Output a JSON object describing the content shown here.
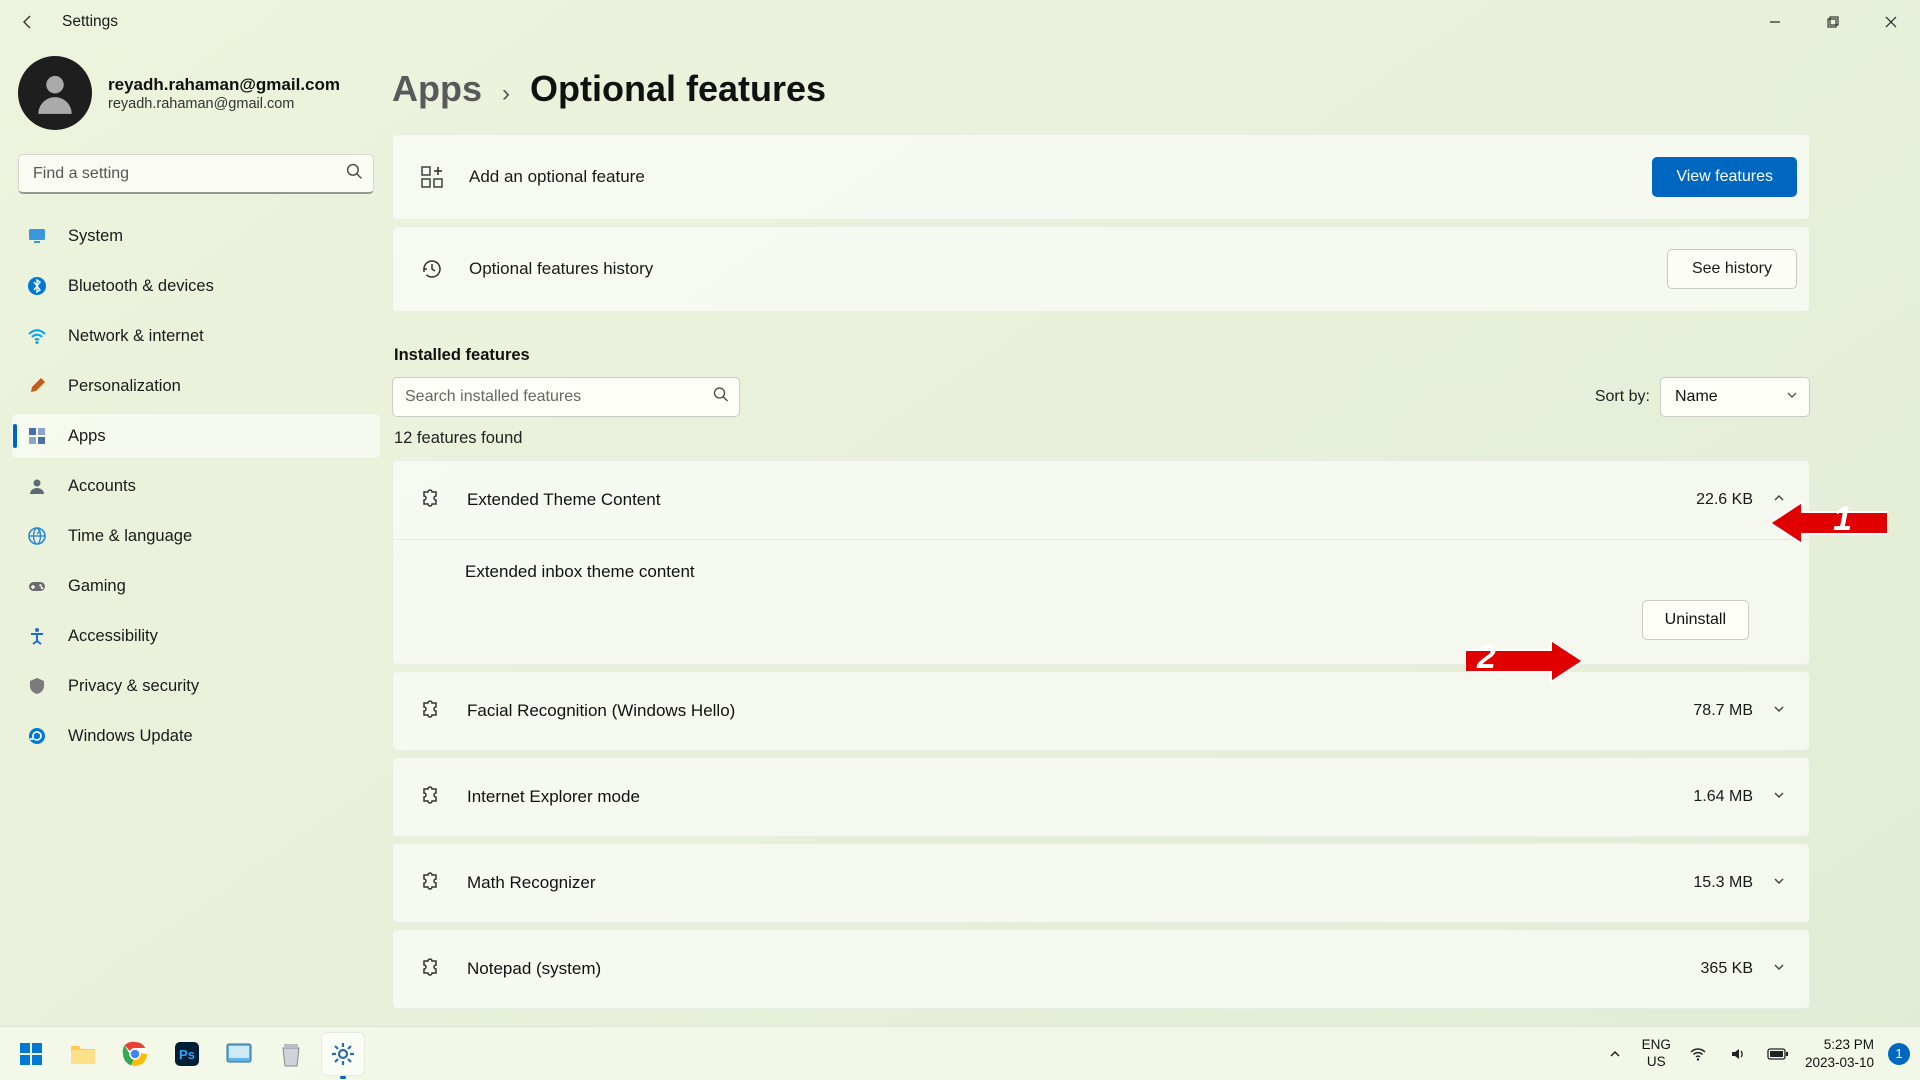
{
  "window": {
    "title": "Settings"
  },
  "profile": {
    "name": "reyadh.rahaman@gmail.com",
    "email": "reyadh.rahaman@gmail.com"
  },
  "search": {
    "placeholder": "Find a setting"
  },
  "nav": [
    {
      "label": "System",
      "icon": "monitor",
      "color": "#3a96dd"
    },
    {
      "label": "Bluetooth & devices",
      "icon": "bluetooth",
      "color": "#0078d4"
    },
    {
      "label": "Network & internet",
      "icon": "wifi",
      "color": "#00a4ef"
    },
    {
      "label": "Personalization",
      "icon": "brush",
      "color": "#c35b1a"
    },
    {
      "label": "Apps",
      "icon": "apps",
      "color": "#4a6fa5",
      "active": true
    },
    {
      "label": "Accounts",
      "icon": "user",
      "color": "#5b6b73"
    },
    {
      "label": "Time & language",
      "icon": "globe",
      "color": "#2b88d8"
    },
    {
      "label": "Gaming",
      "icon": "game",
      "color": "#6b6b6b"
    },
    {
      "label": "Accessibility",
      "icon": "access",
      "color": "#1c6dd0"
    },
    {
      "label": "Privacy & security",
      "icon": "shield",
      "color": "#7a7a7a"
    },
    {
      "label": "Windows Update",
      "icon": "update",
      "color": "#0078d4"
    }
  ],
  "breadcrumb": {
    "parent": "Apps",
    "current": "Optional features"
  },
  "cards": {
    "add": {
      "label": "Add an optional feature",
      "button": "View features"
    },
    "history": {
      "label": "Optional features history",
      "button": "See history"
    }
  },
  "installed": {
    "title": "Installed features",
    "search_placeholder": "Search installed features",
    "sort_label": "Sort by:",
    "sort_value": "Name",
    "count": "12 features found"
  },
  "features": [
    {
      "name": "Extended Theme Content",
      "size": "22.6 KB",
      "expanded": true,
      "desc": "Extended inbox theme content",
      "uninstall": "Uninstall"
    },
    {
      "name": "Facial Recognition (Windows Hello)",
      "size": "78.7 MB"
    },
    {
      "name": "Internet Explorer mode",
      "size": "1.64 MB"
    },
    {
      "name": "Math Recognizer",
      "size": "15.3 MB"
    },
    {
      "name": "Notepad (system)",
      "size": "365 KB"
    }
  ],
  "annotations": {
    "1": "1",
    "2": "2"
  },
  "tray": {
    "lang1": "ENG",
    "lang2": "US",
    "time": "5:23 PM",
    "date": "2023-03-10",
    "badge": "1"
  }
}
